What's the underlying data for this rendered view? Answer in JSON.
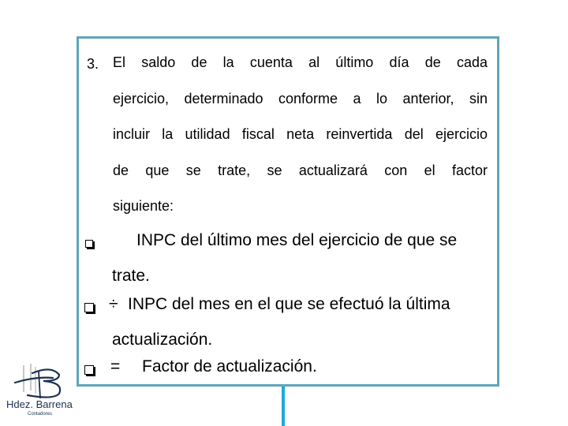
{
  "item": {
    "number": "3.",
    "lines": [
      "El saldo  de la cuenta al último día de cada",
      "ejercicio, determinado conforme a lo anterior, sin",
      "incluir la utilidad fiscal neta reinvertida del ejercicio",
      "de que se trate, se actualizará con el factor",
      "siguiente:"
    ]
  },
  "bullets": [
    {
      "icon": "checkbox-icon",
      "operator": "",
      "line1": "INPC del último mes del ejercicio de que se",
      "line2": "trate."
    },
    {
      "icon": "checkbox-icon",
      "operator": "÷",
      "line1": "INPC del mes en el que se efectuó la última",
      "line2": "actualización."
    },
    {
      "icon": "checkbox-icon",
      "operator": "=",
      "line1": "Factor de actualización.",
      "line2": ""
    }
  ],
  "logo": {
    "name": "Hdez. Barrena",
    "subtitle": "Contadores"
  },
  "colors": {
    "box_border": "#5ea6b9",
    "connector": "#1ea8de",
    "logo_text": "#1c2f50"
  }
}
